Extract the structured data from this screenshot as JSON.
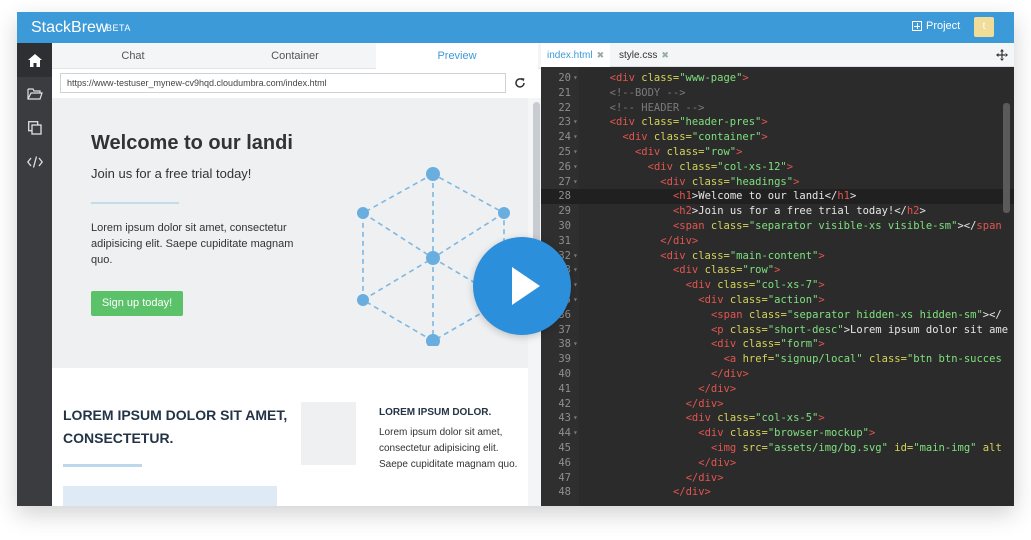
{
  "app": {
    "name": "StackBrew",
    "badge": "BETA",
    "project_label": "Project",
    "avatar_letter": "t"
  },
  "preview_tabs": [
    "Chat",
    "Container",
    "Preview"
  ],
  "active_preview_tab": "Preview",
  "url": "https://www-testuser_mynew-cv9hqd.cloudumbra.com/index.html",
  "hero": {
    "title": "Welcome to our landi",
    "subtitle": "Join us for a free trial today!",
    "description": "Lorem ipsum dolor sit amet, consectetur adipisicing elit. Saepe cupiditate magnam quo.",
    "button": "Sign up today!"
  },
  "lower": {
    "headline": "LOREM IPSUM DOLOR SIT AMET, CONSECTETUR.",
    "side_title": "LOREM IPSUM DOLOR.",
    "side_text": "Lorem ipsum dolor sit amet, consectetur adipisicing elit. Saepe cupiditate magnam quo."
  },
  "editor_tabs": [
    "index.html",
    "style.css"
  ],
  "active_editor_tab": "index.html",
  "code": {
    "current_line": 28,
    "lines": [
      {
        "n": 20,
        "fold": true,
        "ind": 2,
        "seg": [
          [
            "t",
            "<div "
          ],
          [
            "a",
            "class="
          ],
          [
            "s",
            "\"www-page\""
          ],
          [
            "t",
            ">"
          ]
        ]
      },
      {
        "n": 21,
        "fold": false,
        "ind": 2,
        "seg": [
          [
            "c",
            "<!--BODY -->"
          ]
        ]
      },
      {
        "n": 22,
        "fold": false,
        "ind": 2,
        "seg": [
          [
            "c",
            "<!-- HEADER -->"
          ]
        ]
      },
      {
        "n": 23,
        "fold": true,
        "ind": 2,
        "seg": [
          [
            "t",
            "<div "
          ],
          [
            "a",
            "class="
          ],
          [
            "s",
            "\"header-pres\""
          ],
          [
            "t",
            ">"
          ]
        ]
      },
      {
        "n": 24,
        "fold": true,
        "ind": 4,
        "seg": [
          [
            "t",
            "<div "
          ],
          [
            "a",
            "class="
          ],
          [
            "s",
            "\"container\""
          ],
          [
            "t",
            ">"
          ]
        ]
      },
      {
        "n": 25,
        "fold": true,
        "ind": 6,
        "seg": [
          [
            "t",
            "<div "
          ],
          [
            "a",
            "class="
          ],
          [
            "s",
            "\"row\""
          ],
          [
            "t",
            ">"
          ]
        ]
      },
      {
        "n": 26,
        "fold": true,
        "ind": 8,
        "seg": [
          [
            "t",
            "<div "
          ],
          [
            "a",
            "class="
          ],
          [
            "s",
            "\"col-xs-12\""
          ],
          [
            "t",
            ">"
          ]
        ]
      },
      {
        "n": 27,
        "fold": true,
        "ind": 10,
        "seg": [
          [
            "t",
            "<div "
          ],
          [
            "a",
            "class="
          ],
          [
            "s",
            "\"headings\""
          ],
          [
            "t",
            ">"
          ]
        ]
      },
      {
        "n": 28,
        "fold": false,
        "ind": 12,
        "seg": [
          [
            "t",
            "<h1"
          ],
          [
            "p",
            ">Welcome to our landi</"
          ],
          [
            "t",
            "h1"
          ],
          [
            "p",
            ">"
          ]
        ]
      },
      {
        "n": 29,
        "fold": false,
        "ind": 12,
        "seg": [
          [
            "t",
            "<h2"
          ],
          [
            "p",
            ">Join us for a free trial today!</"
          ],
          [
            "t",
            "h2"
          ],
          [
            "p",
            ">"
          ]
        ]
      },
      {
        "n": 30,
        "fold": false,
        "ind": 12,
        "seg": [
          [
            "t",
            "<span "
          ],
          [
            "a",
            "class="
          ],
          [
            "s",
            "\"separator visible-xs visible-sm\""
          ],
          [
            "p",
            "></"
          ],
          [
            "t",
            "span"
          ]
        ]
      },
      {
        "n": 31,
        "fold": false,
        "ind": 10,
        "seg": [
          [
            "t",
            "</div>"
          ]
        ]
      },
      {
        "n": 32,
        "fold": true,
        "ind": 10,
        "seg": [
          [
            "t",
            "<div "
          ],
          [
            "a",
            "class="
          ],
          [
            "s",
            "\"main-content\""
          ],
          [
            "t",
            ">"
          ]
        ]
      },
      {
        "n": 33,
        "fold": true,
        "ind": 12,
        "seg": [
          [
            "t",
            "<div "
          ],
          [
            "a",
            "class="
          ],
          [
            "s",
            "\"row\""
          ],
          [
            "t",
            ">"
          ]
        ]
      },
      {
        "n": 34,
        "fold": true,
        "ind": 14,
        "seg": [
          [
            "t",
            "<div "
          ],
          [
            "a",
            "class="
          ],
          [
            "s",
            "\"col-xs-7\""
          ],
          [
            "t",
            ">"
          ]
        ]
      },
      {
        "n": 35,
        "fold": true,
        "ind": 16,
        "seg": [
          [
            "t",
            "<div "
          ],
          [
            "a",
            "class="
          ],
          [
            "s",
            "\"action\""
          ],
          [
            "t",
            ">"
          ]
        ]
      },
      {
        "n": 36,
        "fold": false,
        "ind": 18,
        "seg": [
          [
            "t",
            "<span "
          ],
          [
            "a",
            "class="
          ],
          [
            "s",
            "\"separator hidden-xs hidden-sm\""
          ],
          [
            "p",
            "></"
          ]
        ]
      },
      {
        "n": 37,
        "fold": false,
        "ind": 18,
        "seg": [
          [
            "t",
            "<p "
          ],
          [
            "a",
            "class="
          ],
          [
            "s",
            "\"short-desc\""
          ],
          [
            "p",
            ">Lorem ipsum dolor sit ame"
          ]
        ]
      },
      {
        "n": 38,
        "fold": true,
        "ind": 18,
        "seg": [
          [
            "t",
            "<div "
          ],
          [
            "a",
            "class="
          ],
          [
            "s",
            "\"form\""
          ],
          [
            "t",
            ">"
          ]
        ]
      },
      {
        "n": 39,
        "fold": false,
        "ind": 20,
        "seg": [
          [
            "t",
            "<a "
          ],
          [
            "a",
            "href="
          ],
          [
            "s",
            "\"signup/local\" "
          ],
          [
            "a",
            "class="
          ],
          [
            "s",
            "\"btn btn-succes"
          ]
        ]
      },
      {
        "n": 40,
        "fold": false,
        "ind": 18,
        "seg": [
          [
            "t",
            "</div>"
          ]
        ]
      },
      {
        "n": 41,
        "fold": false,
        "ind": 16,
        "seg": [
          [
            "t",
            "</div>"
          ]
        ]
      },
      {
        "n": 42,
        "fold": false,
        "ind": 14,
        "seg": [
          [
            "t",
            "</div>"
          ]
        ]
      },
      {
        "n": 43,
        "fold": true,
        "ind": 14,
        "seg": [
          [
            "t",
            "<div "
          ],
          [
            "a",
            "class="
          ],
          [
            "s",
            "\"col-xs-5\""
          ],
          [
            "t",
            ">"
          ]
        ]
      },
      {
        "n": 44,
        "fold": true,
        "ind": 16,
        "seg": [
          [
            "t",
            "<div "
          ],
          [
            "a",
            "class="
          ],
          [
            "s",
            "\"browser-mockup\""
          ],
          [
            "t",
            ">"
          ]
        ]
      },
      {
        "n": 45,
        "fold": false,
        "ind": 18,
        "seg": [
          [
            "t",
            "<img "
          ],
          [
            "a",
            "src="
          ],
          [
            "s",
            "\"assets/img/bg.svg\" "
          ],
          [
            "a",
            "id="
          ],
          [
            "s",
            "\"main-img\" "
          ],
          [
            "a",
            "alt"
          ]
        ]
      },
      {
        "n": 46,
        "fold": false,
        "ind": 16,
        "seg": [
          [
            "t",
            "</div>"
          ]
        ]
      },
      {
        "n": 47,
        "fold": false,
        "ind": 14,
        "seg": [
          [
            "t",
            "</div>"
          ]
        ]
      },
      {
        "n": 48,
        "fold": false,
        "ind": 12,
        "seg": [
          [
            "t",
            "</div>"
          ]
        ]
      }
    ]
  }
}
